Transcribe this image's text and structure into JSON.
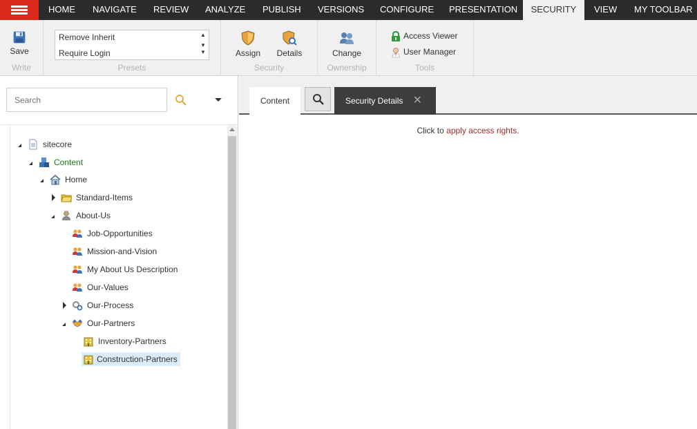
{
  "menubar": {
    "tabs": [
      {
        "label": "HOME"
      },
      {
        "label": "NAVIGATE"
      },
      {
        "label": "REVIEW"
      },
      {
        "label": "ANALYZE"
      },
      {
        "label": "PUBLISH"
      },
      {
        "label": "VERSIONS"
      },
      {
        "label": "CONFIGURE"
      },
      {
        "label": "PRESENTATION"
      },
      {
        "label": "SECURITY",
        "active": true
      },
      {
        "label": "VIEW"
      },
      {
        "label": "MY TOOLBAR"
      }
    ],
    "accent": "#dc291e"
  },
  "ribbon": {
    "write": {
      "save_label": "Save",
      "group_label": "Write"
    },
    "presets": {
      "items": [
        "Remove Inherit",
        "Require Login"
      ],
      "group_label": "Presets"
    },
    "security": {
      "assign_label": "Assign",
      "details_label": "Details",
      "group_label": "Security"
    },
    "ownership": {
      "change_label": "Change",
      "group_label": "Ownership"
    },
    "tools": {
      "access_viewer_label": "Access Viewer",
      "user_manager_label": "User Manager",
      "group_label": "Tools"
    }
  },
  "search": {
    "placeholder": "Search"
  },
  "tree": {
    "nodes": [
      {
        "label": "sitecore",
        "icon": "document-icon",
        "state": "expanded"
      },
      {
        "label": "Content",
        "icon": "cubes-icon",
        "state": "expanded"
      },
      {
        "label": "Home",
        "icon": "home-icon",
        "state": "expanded"
      },
      {
        "label": "Standard-Items",
        "icon": "folder-icon",
        "state": "collapsed"
      },
      {
        "label": "About-Us",
        "icon": "person-icon",
        "state": "expanded"
      },
      {
        "label": "Job-Opportunities",
        "icon": "people-icon",
        "state": "leaf"
      },
      {
        "label": "Mission-and-Vision",
        "icon": "people-icon",
        "state": "leaf"
      },
      {
        "label": "My About Us Description",
        "icon": "people-icon",
        "state": "leaf"
      },
      {
        "label": "Our-Values",
        "icon": "people-icon",
        "state": "leaf"
      },
      {
        "label": "Our-Process",
        "icon": "gears-icon",
        "state": "collapsed"
      },
      {
        "label": "Our-Partners",
        "icon": "handshake-icon",
        "state": "expanded"
      },
      {
        "label": "Inventory-Partners",
        "icon": "building-icon",
        "state": "leaf"
      },
      {
        "label": "Construction-Partners",
        "icon": "building-icon",
        "state": "leaf",
        "selected": true
      }
    ]
  },
  "content_tabs": {
    "content_label": "Content",
    "security_details_label": "Security Details"
  },
  "message": {
    "prefix": "Click to ",
    "link": "apply access rights",
    "suffix": "."
  }
}
